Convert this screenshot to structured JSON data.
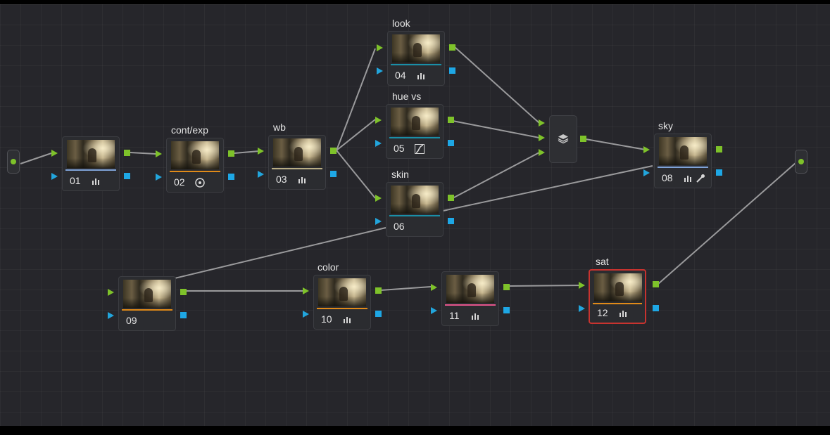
{
  "nodes": [
    {
      "id": "n01",
      "number": "01",
      "label": "",
      "tool_icon": "bars-icon"
    },
    {
      "id": "n02",
      "number": "02",
      "label": "cont/exp",
      "tool_icon": "target-icon"
    },
    {
      "id": "n03",
      "number": "03",
      "label": "wb",
      "tool_icon": "bars-icon"
    },
    {
      "id": "n04",
      "number": "04",
      "label": "look",
      "tool_icon": "bars-icon"
    },
    {
      "id": "n05",
      "number": "05",
      "label": "hue vs",
      "tool_icon": "curve-icon"
    },
    {
      "id": "n06",
      "number": "06",
      "label": "skin",
      "tool_icon": ""
    },
    {
      "id": "n08",
      "number": "08",
      "label": "sky",
      "tool_icon": "bars-icon",
      "extra_icon": "eyedropper-icon"
    },
    {
      "id": "n09",
      "number": "09",
      "label": "",
      "tool_icon": ""
    },
    {
      "id": "n10",
      "number": "10",
      "label": "color",
      "tool_icon": "bars-icon"
    },
    {
      "id": "n11",
      "number": "11",
      "label": "",
      "tool_icon": "bars-icon"
    },
    {
      "id": "n12",
      "number": "12",
      "label": "sat",
      "tool_icon": "bars-icon",
      "selected": true
    }
  ],
  "layer_mixer": {
    "icon": "layers-icon"
  },
  "colors": {
    "rgb_port": "#7ec22a",
    "key_port": "#1ea7e5",
    "selected_border": "#c8332f",
    "stripe_blue": "#7fa3d8",
    "stripe_orange": "#e08a18",
    "stripe_khaki": "#b9ad84",
    "stripe_teal": "#1a8fa6",
    "stripe_pink": "#e5558b"
  }
}
